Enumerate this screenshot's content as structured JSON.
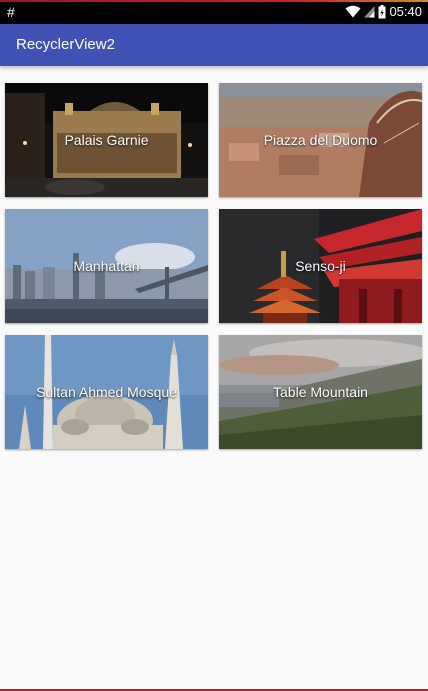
{
  "status_bar": {
    "notification_icon": "hash-icon",
    "notification_glyph": "#",
    "time": "05:40",
    "icons": [
      "wifi-icon",
      "signal-icon",
      "battery-icon"
    ]
  },
  "app_bar": {
    "title": "RecyclerView2",
    "color": "#3f51b5"
  },
  "places": [
    {
      "name": "Palais Garnie"
    },
    {
      "name": "Piazza del Duomo"
    },
    {
      "name": "Manhattan"
    },
    {
      "name": "Senso-ji"
    },
    {
      "name": "Sultan Ahmed Mosque"
    },
    {
      "name": "Table Mountain"
    }
  ]
}
